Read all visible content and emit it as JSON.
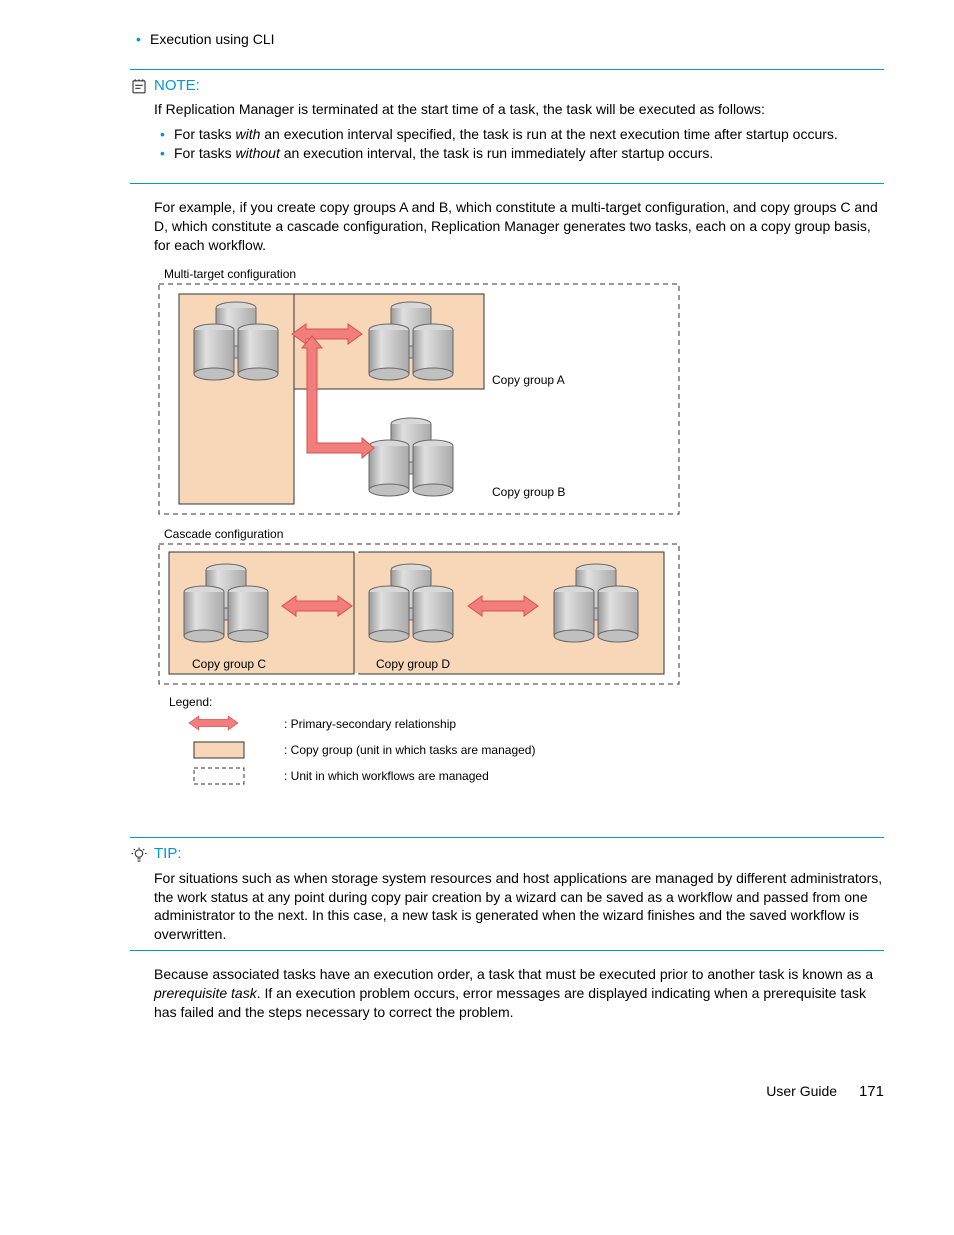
{
  "topBullet": "Execution using CLI",
  "note": {
    "label": "NOTE:",
    "intro": "If Replication Manager is terminated at the start time of a task, the task will be executed as follows:",
    "b1_pre": "For tasks ",
    "b1_em": "with",
    "b1_post": " an execution interval specified, the task is run at the next execution time after startup occurs.",
    "b2_pre": "For tasks ",
    "b2_em": "without",
    "b2_post": " an execution interval, the task is run immediately after startup occurs."
  },
  "examplePara": "For example, if you create copy groups A and B, which constitute a multi-target configuration, and copy groups C and D, which constitute a cascade configuration, Replication Manager generates two tasks, each on a copy group basis, for each workflow.",
  "diagram": {
    "multiTitle": "Multi-target configuration",
    "cgA": "Copy group A",
    "cgB": "Copy group B",
    "cascadeTitle": "Cascade configuration",
    "cgC": "Copy group C",
    "cgD": "Copy group D",
    "legendTitle": "Legend:",
    "l1": ": Primary-secondary relationship",
    "l2": ": Copy group (unit in which tasks are managed)",
    "l3": ": Unit in which workflows are managed"
  },
  "tip": {
    "label": "TIP:",
    "body": "For situations such as when storage system resources and host applications are managed by different administrators, the work status at any point during copy pair creation by a wizard can be saved as a workflow and passed from one administrator to the next. In this case, a new task is generated when the wizard finishes and the saved workflow is overwritten."
  },
  "closingPara_pre": "Because associated tasks have an execution order, a task that must be executed prior to another task is known as a ",
  "closingPara_em": "prerequisite task",
  "closingPara_post": ". If an execution problem occurs, error messages are displayed indicating when a prerequisite task has failed and the steps necessary to correct the problem.",
  "footer": {
    "title": "User Guide",
    "page": "171"
  }
}
